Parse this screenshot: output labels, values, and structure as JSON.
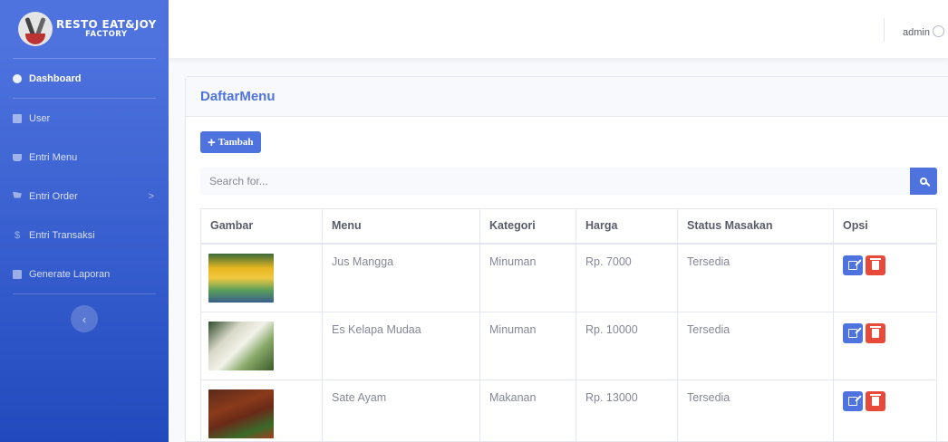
{
  "brand": {
    "line1": "RESTO EAT&JOY",
    "line2": "FACTORY"
  },
  "sidebar": {
    "items": [
      {
        "label": "Dashboard",
        "icon": "tachometer-icon",
        "active": true
      },
      {
        "label": "User",
        "icon": "user-card-icon"
      },
      {
        "label": "Entri Menu",
        "icon": "coffee-icon"
      },
      {
        "label": "Entri Order",
        "icon": "cart-icon",
        "chevron": ">"
      },
      {
        "label": "Entri Transaksi",
        "icon": "dollar-icon"
      },
      {
        "label": "Generate Laporan",
        "icon": "document-icon"
      }
    ],
    "toggle_glyph": "‹"
  },
  "topbar": {
    "user_name": "admin"
  },
  "card": {
    "title": "DaftarMenu",
    "add_button": "Tambah"
  },
  "search": {
    "placeholder": "Search for..."
  },
  "table": {
    "headers": [
      "Gambar",
      "Menu",
      "Kategori",
      "Harga",
      "Status Masakan",
      "Opsi"
    ],
    "rows": [
      {
        "menu": "Jus Mangga",
        "kategori": "Minuman",
        "harga": "Rp. 7000",
        "status": "Tersedia",
        "image": "mango-juice-photo"
      },
      {
        "menu": "Es Kelapa Mudaa",
        "kategori": "Minuman",
        "harga": "Rp. 10000",
        "status": "Tersedia",
        "image": "coconut-ice-photo"
      },
      {
        "menu": "Sate Ayam",
        "kategori": "Makanan",
        "harga": "Rp. 13000",
        "status": "Tersedia",
        "image": "chicken-satay-photo"
      }
    ]
  },
  "colors": {
    "primary": "#4e73df",
    "danger": "#e74a3b",
    "sidebar_gradient_end": "#224abe",
    "text_muted": "#858796"
  }
}
